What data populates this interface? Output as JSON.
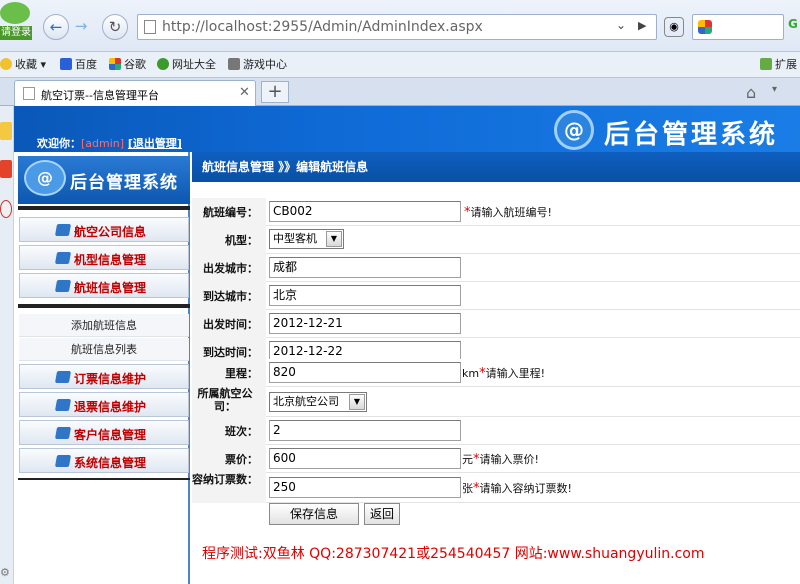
{
  "browser": {
    "login_label": "请登录",
    "url": "http://localhost:2955/Admin/AdminIndex.aspx",
    "favorites_label": "收藏",
    "bookmarks": [
      "百度",
      "谷歌",
      "网址大全",
      "游戏中心"
    ],
    "extend_label": "扩展",
    "tab_title": "航空订票--信息管理平台"
  },
  "header": {
    "welcome_label": "欢迎你：",
    "user": "[admin]",
    "logout_label": "[退出管理]",
    "system_title": "后台管理系统"
  },
  "sidebar": {
    "title": "后台管理系统",
    "top_items": [
      {
        "label": "航空公司信息"
      },
      {
        "label": "机型信息管理"
      },
      {
        "label": "航班信息管理"
      }
    ],
    "sub_items": [
      {
        "label": "添加航班信息"
      },
      {
        "label": "航班信息列表"
      }
    ],
    "bottom_items": [
      {
        "label": "订票信息维护"
      },
      {
        "label": "退票信息维护"
      },
      {
        "label": "客户信息管理"
      },
      {
        "label": "系统信息管理"
      }
    ]
  },
  "breadcrumb": "航班信息管理 》》编辑航班信息",
  "form": {
    "flight_no": {
      "label": "航班编号：",
      "value": "CB002",
      "hint": "请输入航班编号!"
    },
    "model": {
      "label": "机型：",
      "value": "中型客机"
    },
    "depart_city": {
      "label": "出发城市：",
      "value": "成都"
    },
    "arrive_city": {
      "label": "到达城市：",
      "value": "北京"
    },
    "depart_time": {
      "label": "出发时间：",
      "value": "2012-12-21"
    },
    "arrive_time": {
      "label": "到达时间：",
      "value": "2012-12-22"
    },
    "mileage": {
      "label": "里程：",
      "value": "820",
      "unit": "km",
      "hint": "请输入里程!"
    },
    "airline": {
      "label": "所属航空公司：",
      "value": "北京航空公司"
    },
    "shift": {
      "label": "班次：",
      "value": "2"
    },
    "price": {
      "label": "票价：",
      "value": "600",
      "unit": "元",
      "hint": "请输入票价!"
    },
    "capacity": {
      "label": "容纳订票数：",
      "value": "250",
      "unit": "张",
      "hint": "请输入容纳订票数!"
    },
    "required_mark": "*",
    "save_label": "保存信息",
    "back_label": "返回"
  },
  "footer": "程序测试:双鱼林  QQ:287307421或254540457 网站:www.shuangyulin.com"
}
